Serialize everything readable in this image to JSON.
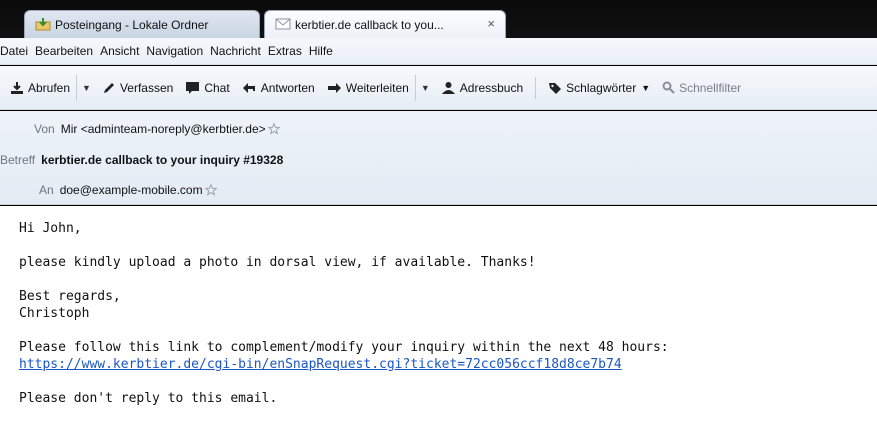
{
  "tabs": [
    {
      "label": "Posteingang - Lokale Ordner",
      "icon": "inbox-icon"
    },
    {
      "label": "kerbtier.de callback to you...",
      "icon": "envelope-icon",
      "close": "×"
    }
  ],
  "menu": [
    "Datei",
    "Bearbeiten",
    "Ansicht",
    "Navigation",
    "Nachricht",
    "Extras",
    "Hilfe"
  ],
  "toolbar": {
    "get_mail": "Abrufen",
    "write": "Verfassen",
    "chat": "Chat",
    "reply": "Antworten",
    "forward": "Weiterleiten",
    "address_book": "Adressbuch",
    "tags": "Schlagwörter",
    "quick_filter": "Schnellfilter"
  },
  "header": {
    "from_label": "Von",
    "from_value": "Mir <adminteam-noreply@kerbtier.de>",
    "subject_label": "Betreff",
    "subject_value": "kerbtier.de callback to your inquiry #19328",
    "to_label": "An",
    "to_value": "doe@example-mobile.com"
  },
  "body": {
    "greeting": "Hi John,",
    "line1": "please kindly upload a photo in dorsal view, if available. Thanks!",
    "regards": "Best regards,",
    "signature": "Christoph",
    "link_intro": "Please follow this link to complement/modify your inquiry within the next 48 hours:",
    "link_url": "https://www.kerbtier.de/cgi-bin/enSnapRequest.cgi?ticket=72cc056ccf18d8ce7b74",
    "no_reply": "Please don't reply to this email."
  },
  "colors": {
    "link": "#1a56c8",
    "accent": "#3a78d6"
  }
}
